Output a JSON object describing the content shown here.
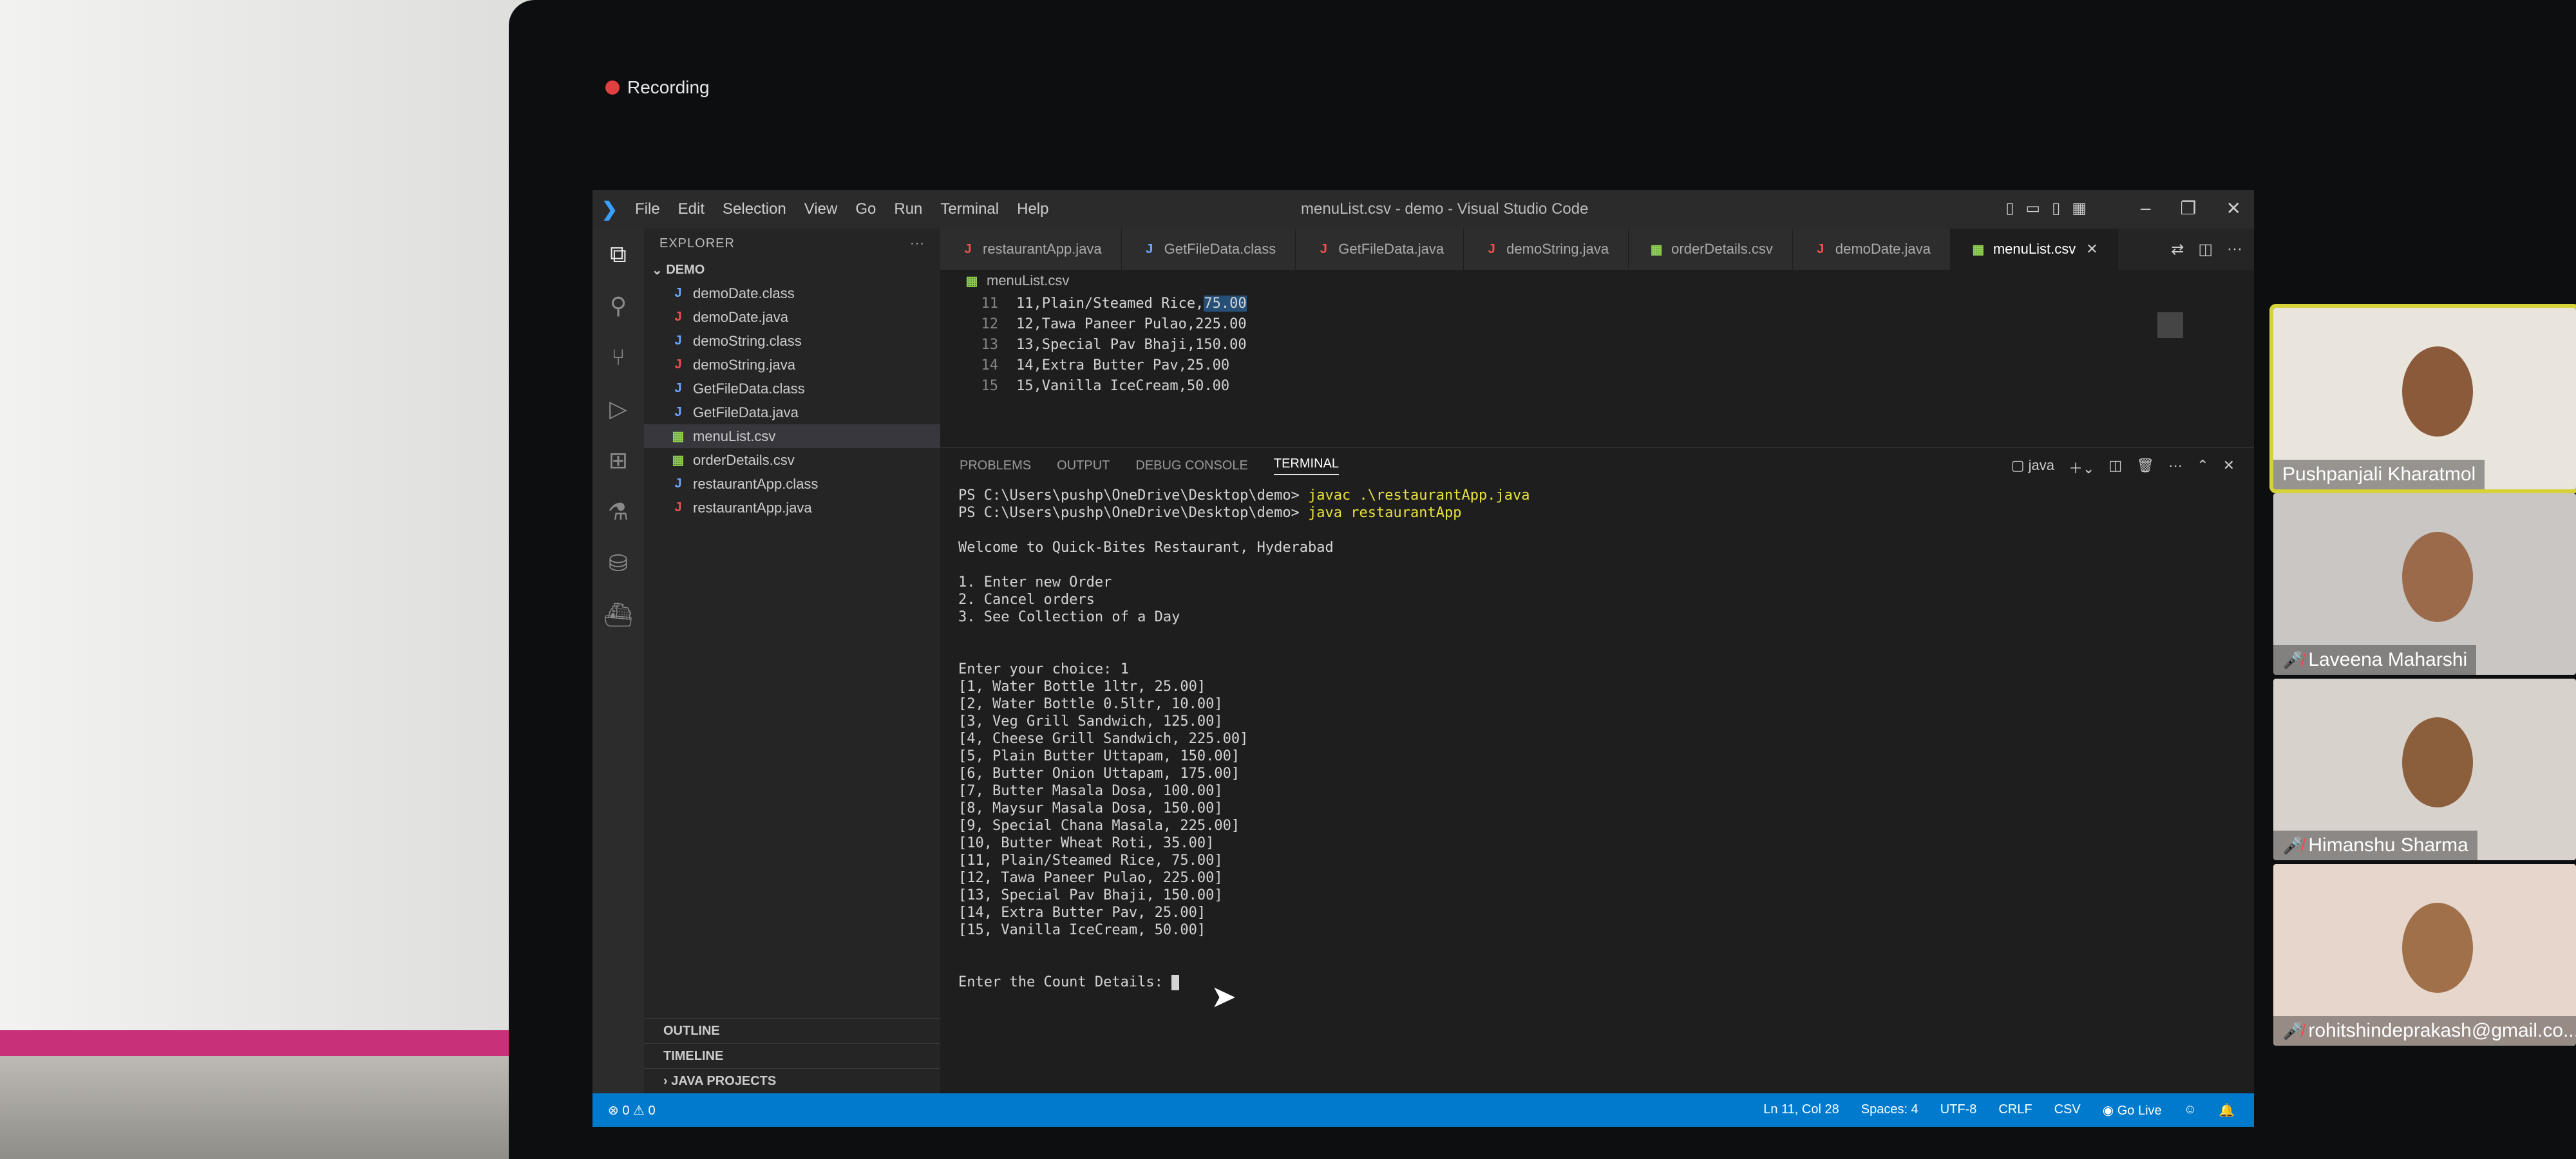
{
  "recording": {
    "label": "Recording"
  },
  "window": {
    "title": "menuList.csv - demo - Visual Studio Code",
    "menu": [
      "File",
      "Edit",
      "Selection",
      "View",
      "Go",
      "Run",
      "Terminal",
      "Help"
    ]
  },
  "sidebar": {
    "header": "EXPLORER",
    "folder": "DEMO",
    "files": [
      {
        "name": "demoDate.class",
        "type": "class"
      },
      {
        "name": "demoDate.java",
        "type": "java"
      },
      {
        "name": "demoString.class",
        "type": "class"
      },
      {
        "name": "demoString.java",
        "type": "java"
      },
      {
        "name": "GetFileData.class",
        "type": "class"
      },
      {
        "name": "GetFileData.java",
        "type": "class"
      },
      {
        "name": "menuList.csv",
        "type": "csv"
      },
      {
        "name": "orderDetails.csv",
        "type": "csv"
      },
      {
        "name": "restaurantApp.class",
        "type": "class"
      },
      {
        "name": "restaurantApp.java",
        "type": "java"
      }
    ],
    "sections": [
      "OUTLINE",
      "TIMELINE",
      "JAVA PROJECTS"
    ]
  },
  "tabs": [
    {
      "label": "restaurantApp.java",
      "type": "java"
    },
    {
      "label": "GetFileData.class",
      "type": "class"
    },
    {
      "label": "GetFileData.java",
      "type": "java"
    },
    {
      "label": "demoString.java",
      "type": "java"
    },
    {
      "label": "orderDetails.csv",
      "type": "csv"
    },
    {
      "label": "demoDate.java",
      "type": "java"
    },
    {
      "label": "menuList.csv",
      "type": "csv"
    }
  ],
  "breadcrumb": "menuList.csv",
  "editor": {
    "lines": [
      {
        "num": "11",
        "text": "11,Plain/Steamed Rice,",
        "hl": "75.00"
      },
      {
        "num": "12",
        "text": "12,Tawa Paneer Pulao,225.00",
        "hl": ""
      },
      {
        "num": "13",
        "text": "13,Special Pav Bhaji,150.00",
        "hl": ""
      },
      {
        "num": "14",
        "text": "14,Extra Butter Pav,25.00",
        "hl": ""
      },
      {
        "num": "15",
        "text": "15,Vanilla IceCream,50.00",
        "hl": ""
      }
    ]
  },
  "panel": {
    "tabs": [
      "PROBLEMS",
      "OUTPUT",
      "DEBUG CONSOLE",
      "TERMINAL"
    ],
    "shell": "java"
  },
  "terminal": {
    "prompt1": "PS C:\\Users\\pushp\\OneDrive\\Desktop\\demo> ",
    "cmd1": "javac .\\restaurantApp.java",
    "prompt2": "PS C:\\Users\\pushp\\OneDrive\\Desktop\\demo> ",
    "cmd2": "java restaurantApp",
    "welcome": "Welcome to Quick-Bites Restaurant, Hyderabad",
    "options": [
      "1. Enter new Order",
      "2. Cancel orders",
      "3. See Collection of a Day"
    ],
    "choice": "Enter your choice: 1",
    "items": [
      "[1, Water Bottle 1ltr, 25.00]",
      "[2, Water Bottle 0.5ltr, 10.00]",
      "[3, Veg Grill Sandwich, 125.00]",
      "[4, Cheese Grill Sandwich, 225.00]",
      "[5, Plain Butter Uttapam, 150.00]",
      "[6, Butter Onion Uttapam, 175.00]",
      "[7, Butter Masala Dosa, 100.00]",
      "[8, Maysur Masala Dosa, 150.00]",
      "[9, Special Chana Masala, 225.00]",
      "[10, Butter Wheat Roti, 35.00]",
      "[11, Plain/Steamed Rice, 75.00]",
      "[12, Tawa Paneer Pulao, 225.00]",
      "[13, Special Pav Bhaji, 150.00]",
      "[14, Extra Butter Pav, 25.00]",
      "[15, Vanilla IceCream, 50.00]"
    ],
    "input_prompt": "Enter the Count Details: "
  },
  "status": {
    "problems": "⊗ 0 ⚠ 0",
    "position": "Ln 11, Col 28",
    "spaces": "Spaces: 4",
    "encoding": "UTF-8",
    "eol": "CRLF",
    "language": "CSV",
    "golive": "Go Live"
  },
  "participants": [
    {
      "name": "Pushpanjali Kharatmol",
      "muted": false,
      "bg": "#e9e4dc",
      "face": "#8a5a3a"
    },
    {
      "name": "Laveena Maharshi",
      "muted": true,
      "bg": "#c9c6c3",
      "face": "#9a6a4a"
    },
    {
      "name": "Himanshu Sharma",
      "muted": true,
      "bg": "#d8d2cc",
      "face": "#8b5e3c"
    },
    {
      "name": "rohitshindeprakash@gmail.co...",
      "muted": true,
      "bg": "#e6d6cc",
      "face": "#a0704a"
    }
  ]
}
